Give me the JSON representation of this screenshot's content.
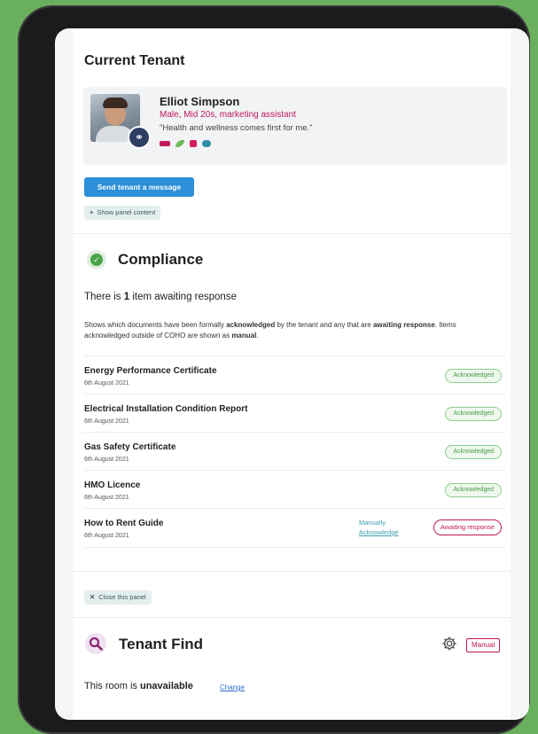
{
  "current_tenant": {
    "title": "Current Tenant",
    "name": "Elliot Simpson",
    "meta": "Male, Mid 20s, marketing assistant",
    "quote": "\"Health and wellness comes first for me.\"",
    "interest_icons": [
      "sport-icon",
      "leaf-icon",
      "book-icon",
      "gamepad-icon"
    ],
    "send_message_label": "Send tenant a message",
    "show_panel_label": "Show panel content"
  },
  "compliance": {
    "title": "Compliance",
    "summary_prefix": "There is ",
    "summary_count": "1",
    "summary_suffix": " item awaiting response",
    "desc_1": "Shows which documents have been formally ",
    "desc_b1": "acknowledged",
    "desc_2": " by the tenant and any that are ",
    "desc_b2": "awaiting response",
    "desc_3": ". Items acknowledged outside of COHO are shown as ",
    "desc_b3": "manual",
    "desc_4": ".",
    "items": [
      {
        "title": "Energy Performance Certificate",
        "date": "6th August 2021",
        "status": "Acknowledged"
      },
      {
        "title": "Electrical Installation Condition Report",
        "date": "6th August 2021",
        "status": "Acknowledged"
      },
      {
        "title": "Gas Safety Certificate",
        "date": "6th August 2021",
        "status": "Acknowledged"
      },
      {
        "title": "HMO Licence",
        "date": "6th August 2021",
        "status": "Acknowledged"
      },
      {
        "title": "How to Rent Guide",
        "date": "6th August 2021",
        "status": "Awaiting response",
        "manual_line1": "Manually",
        "manual_line2": "Acknowledge"
      }
    ],
    "close_label": "Close this panel"
  },
  "tenant_find": {
    "title": "Tenant Find",
    "manual_badge": "Manual",
    "room_prefix": "This room is ",
    "room_status": "unavailable",
    "change_label": "Change"
  },
  "colors": {
    "background": "#6aaf5e",
    "accent_blue": "#2b8fd9",
    "magenta": "#c2185b",
    "ack_green": "#4a9a48"
  }
}
